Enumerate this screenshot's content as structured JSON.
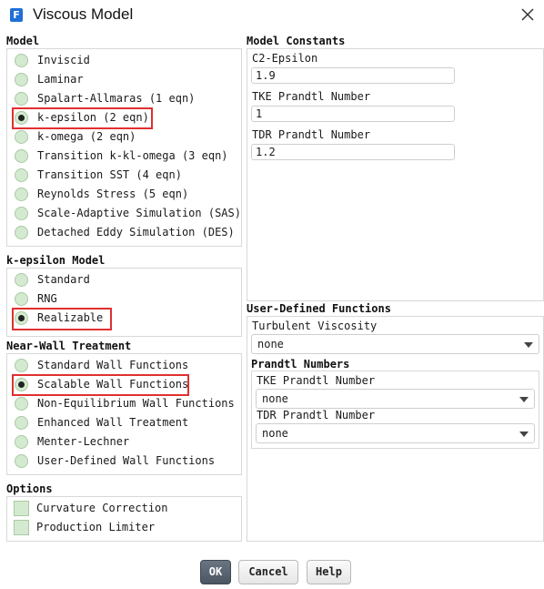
{
  "window": {
    "title": "Viscous Model",
    "app_icon_letter": "F"
  },
  "model": {
    "title": "Model",
    "options": [
      {
        "label": "Inviscid",
        "selected": false
      },
      {
        "label": "Laminar",
        "selected": false
      },
      {
        "label": "Spalart-Allmaras (1 eqn)",
        "selected": false
      },
      {
        "label": "k-epsilon (2 eqn)",
        "selected": true
      },
      {
        "label": "k-omega (2 eqn)",
        "selected": false
      },
      {
        "label": "Transition k-kl-omega (3 eqn)",
        "selected": false
      },
      {
        "label": "Transition SST (4 eqn)",
        "selected": false
      },
      {
        "label": "Reynolds Stress (5 eqn)",
        "selected": false
      },
      {
        "label": "Scale-Adaptive Simulation (SAS)",
        "selected": false
      },
      {
        "label": "Detached Eddy Simulation (DES)",
        "selected": false
      }
    ]
  },
  "kepsilon_model": {
    "title": "k-epsilon Model",
    "options": [
      {
        "label": "Standard",
        "selected": false
      },
      {
        "label": "RNG",
        "selected": false
      },
      {
        "label": "Realizable",
        "selected": true
      }
    ]
  },
  "near_wall": {
    "title": "Near-Wall Treatment",
    "options": [
      {
        "label": "Standard Wall Functions",
        "selected": false
      },
      {
        "label": "Scalable Wall Functions",
        "selected": true
      },
      {
        "label": "Non-Equilibrium Wall Functions",
        "selected": false
      },
      {
        "label": "Enhanced Wall Treatment",
        "selected": false
      },
      {
        "label": "Menter-Lechner",
        "selected": false
      },
      {
        "label": "User-Defined Wall Functions",
        "selected": false
      }
    ]
  },
  "options": {
    "title": "Options",
    "items": [
      {
        "label": "Curvature Correction",
        "checked": false
      },
      {
        "label": "Production Limiter",
        "checked": false
      }
    ]
  },
  "model_constants": {
    "title": "Model Constants",
    "fields": [
      {
        "label": "C2-Epsilon",
        "value": "1.9"
      },
      {
        "label": "TKE Prandtl Number",
        "value": "1"
      },
      {
        "label": "TDR Prandtl Number",
        "value": "1.2"
      }
    ]
  },
  "udf": {
    "title": "User-Defined Functions",
    "turbulent_viscosity_label": "Turbulent Viscosity",
    "turbulent_viscosity_value": "none",
    "prandtl_title": "Prandtl Numbers",
    "tke_label": "TKE Prandtl Number",
    "tke_value": "none",
    "tdr_label": "TDR Prandtl Number",
    "tdr_value": "none"
  },
  "buttons": {
    "ok": "OK",
    "cancel": "Cancel",
    "help": "Help"
  },
  "colors": {
    "highlight": "#e03030",
    "radio_fill": "#d4ead0",
    "ok_button": "#5a6470"
  }
}
